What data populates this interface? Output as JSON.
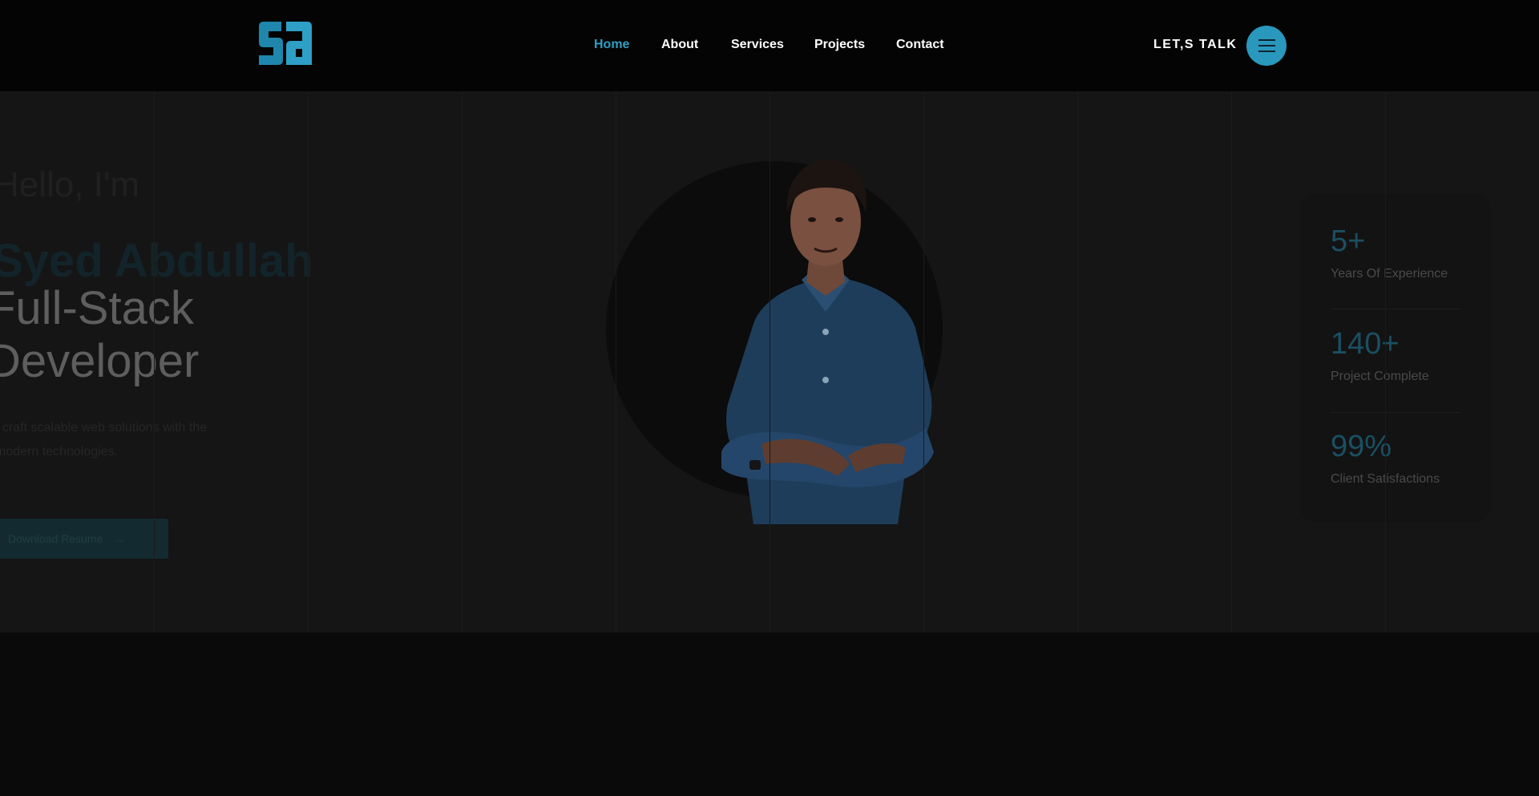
{
  "header": {
    "logo_text": "sa",
    "nav": [
      "Home",
      "About",
      "Services",
      "Projects",
      "Contact"
    ],
    "active_nav": "Home",
    "cta_label": "LET,S TALK",
    "menu_icon": "hamburger-icon"
  },
  "hero": {
    "greeting": "Hello, I'm",
    "name": "Syed Abdullah",
    "role_line1": "Full-Stack",
    "role_line2": "Developer",
    "intro_line1": "I craft scalable web solutions with the",
    "intro_line2": "modern technologies.",
    "button_label": "Download Resume",
    "button_icon": "arrow-right-icon"
  },
  "stats": [
    {
      "value": "5+",
      "label": "Years Of Experience"
    },
    {
      "value": "140+",
      "label": "Project Complete"
    },
    {
      "value": "99%",
      "label": "Client Satisfactions"
    }
  ],
  "colors": {
    "accent": "#2e9fc5",
    "header_bg": "#040404",
    "hero_bg": "#151515"
  }
}
